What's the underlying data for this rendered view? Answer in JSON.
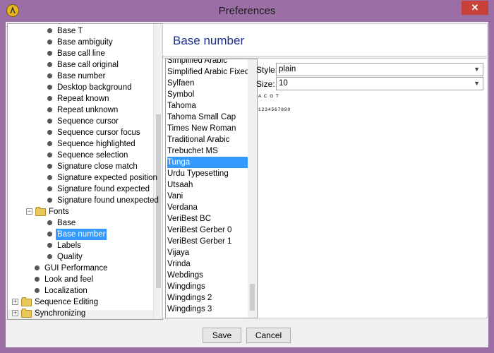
{
  "window": {
    "title": "Preferences",
    "close_label": "✕"
  },
  "tree": {
    "items": [
      {
        "label": "Base T",
        "level": 3
      },
      {
        "label": "Base ambiguity",
        "level": 3
      },
      {
        "label": "Base call line",
        "level": 3
      },
      {
        "label": "Base call original",
        "level": 3
      },
      {
        "label": "Base number",
        "level": 3
      },
      {
        "label": "Desktop background",
        "level": 3
      },
      {
        "label": "Repeat known",
        "level": 3
      },
      {
        "label": "Repeat unknown",
        "level": 3
      },
      {
        "label": "Sequence cursor",
        "level": 3
      },
      {
        "label": "Sequence cursor focus",
        "level": 3
      },
      {
        "label": "Sequence highlighted",
        "level": 3
      },
      {
        "label": "Sequence selection",
        "level": 3
      },
      {
        "label": "Signature close match",
        "level": 3
      },
      {
        "label": "Signature expected position",
        "level": 3
      },
      {
        "label": "Signature found expected",
        "level": 3
      },
      {
        "label": "Signature found unexpected",
        "level": 3
      },
      {
        "label": "Fonts",
        "level": 2,
        "folder": true,
        "expander": "−"
      },
      {
        "label": "Base",
        "level": 3
      },
      {
        "label": "Base number",
        "level": 3,
        "selected": true
      },
      {
        "label": "Labels",
        "level": 3
      },
      {
        "label": "Quality",
        "level": 3
      },
      {
        "label": "GUI Performance",
        "level": 2
      },
      {
        "label": "Look and feel",
        "level": 2
      },
      {
        "label": "Localization",
        "level": 2
      },
      {
        "label": "Sequence Editing",
        "level": 1,
        "folder": true,
        "expander": "+"
      },
      {
        "label": "Synchronizing",
        "level": 1,
        "folder": true,
        "expander": "+"
      }
    ]
  },
  "panel": {
    "title": "Base number"
  },
  "font_list": {
    "items": [
      "Simplified Arabic",
      "Simplified Arabic Fixed",
      "Sylfaen",
      "Symbol",
      "Tahoma",
      "Tahoma Small Cap",
      "Times New Roman",
      "Traditional Arabic",
      "Trebuchet MS",
      "Tunga",
      "Urdu Typesetting",
      "Utsaah",
      "Vani",
      "Verdana",
      "VeriBest BC",
      "VeriBest Gerber 0",
      "VeriBest Gerber 1",
      "Vijaya",
      "Vrinda",
      "Webdings",
      "Wingdings",
      "Wingdings 2",
      "Wingdings 3"
    ],
    "selected": "Tunga"
  },
  "style": {
    "label": "Style:",
    "value": "plain"
  },
  "size": {
    "label": "Size:",
    "value": "10"
  },
  "preview": {
    "bases": "A C G T",
    "numbers": "1234567890"
  },
  "buttons": {
    "save": "Save",
    "cancel": "Cancel"
  },
  "colors": {
    "titlebar": "#9b6fa6",
    "selection": "#3399ff",
    "heading": "#1a2e8a",
    "close": "#c7403a"
  }
}
